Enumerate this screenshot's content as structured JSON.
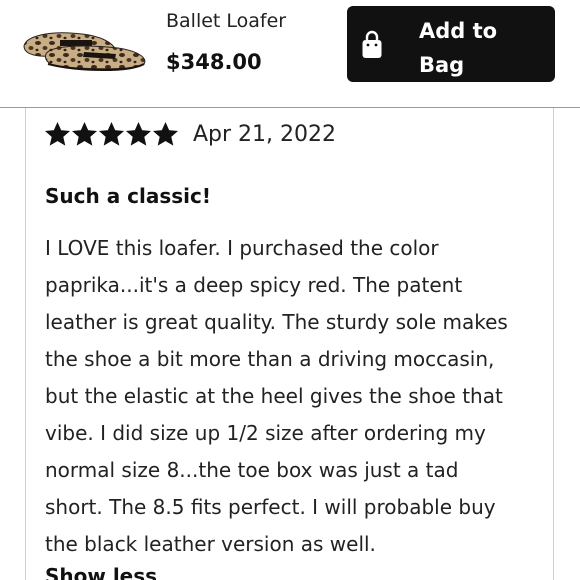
{
  "product": {
    "name": "Ballet Loafer",
    "price": "$348.00",
    "image_icon": "leopard-print-loafer-thumbnail"
  },
  "cart_button": {
    "label": "Add to Bag",
    "icon": "shopping-bag-icon"
  },
  "review": {
    "rating": 5,
    "rating_max": 5,
    "date": "Apr 21, 2022",
    "title": "Such a classic!",
    "body_lines": [
      "I LOVE this loafer. I purchased the color",
      "paprika...it's a deep spicy red. The patent",
      "leather is great quality. The sturdy sole makes",
      "the shoe a bit more than a driving moccasin,",
      "but the elastic at the heel gives the shoe that",
      "vibe. I did size up 1/2 size after ordering my",
      "normal size 8...the toe box was just a tad",
      "short. The 8.5 fits perfect. I will probable buy",
      "the black leather version as well."
    ],
    "toggle_label": "Show less"
  },
  "colors": {
    "button_bg": "#111111",
    "button_text": "#ffffff",
    "star": "#111111",
    "divider": "#9a9a9a"
  }
}
